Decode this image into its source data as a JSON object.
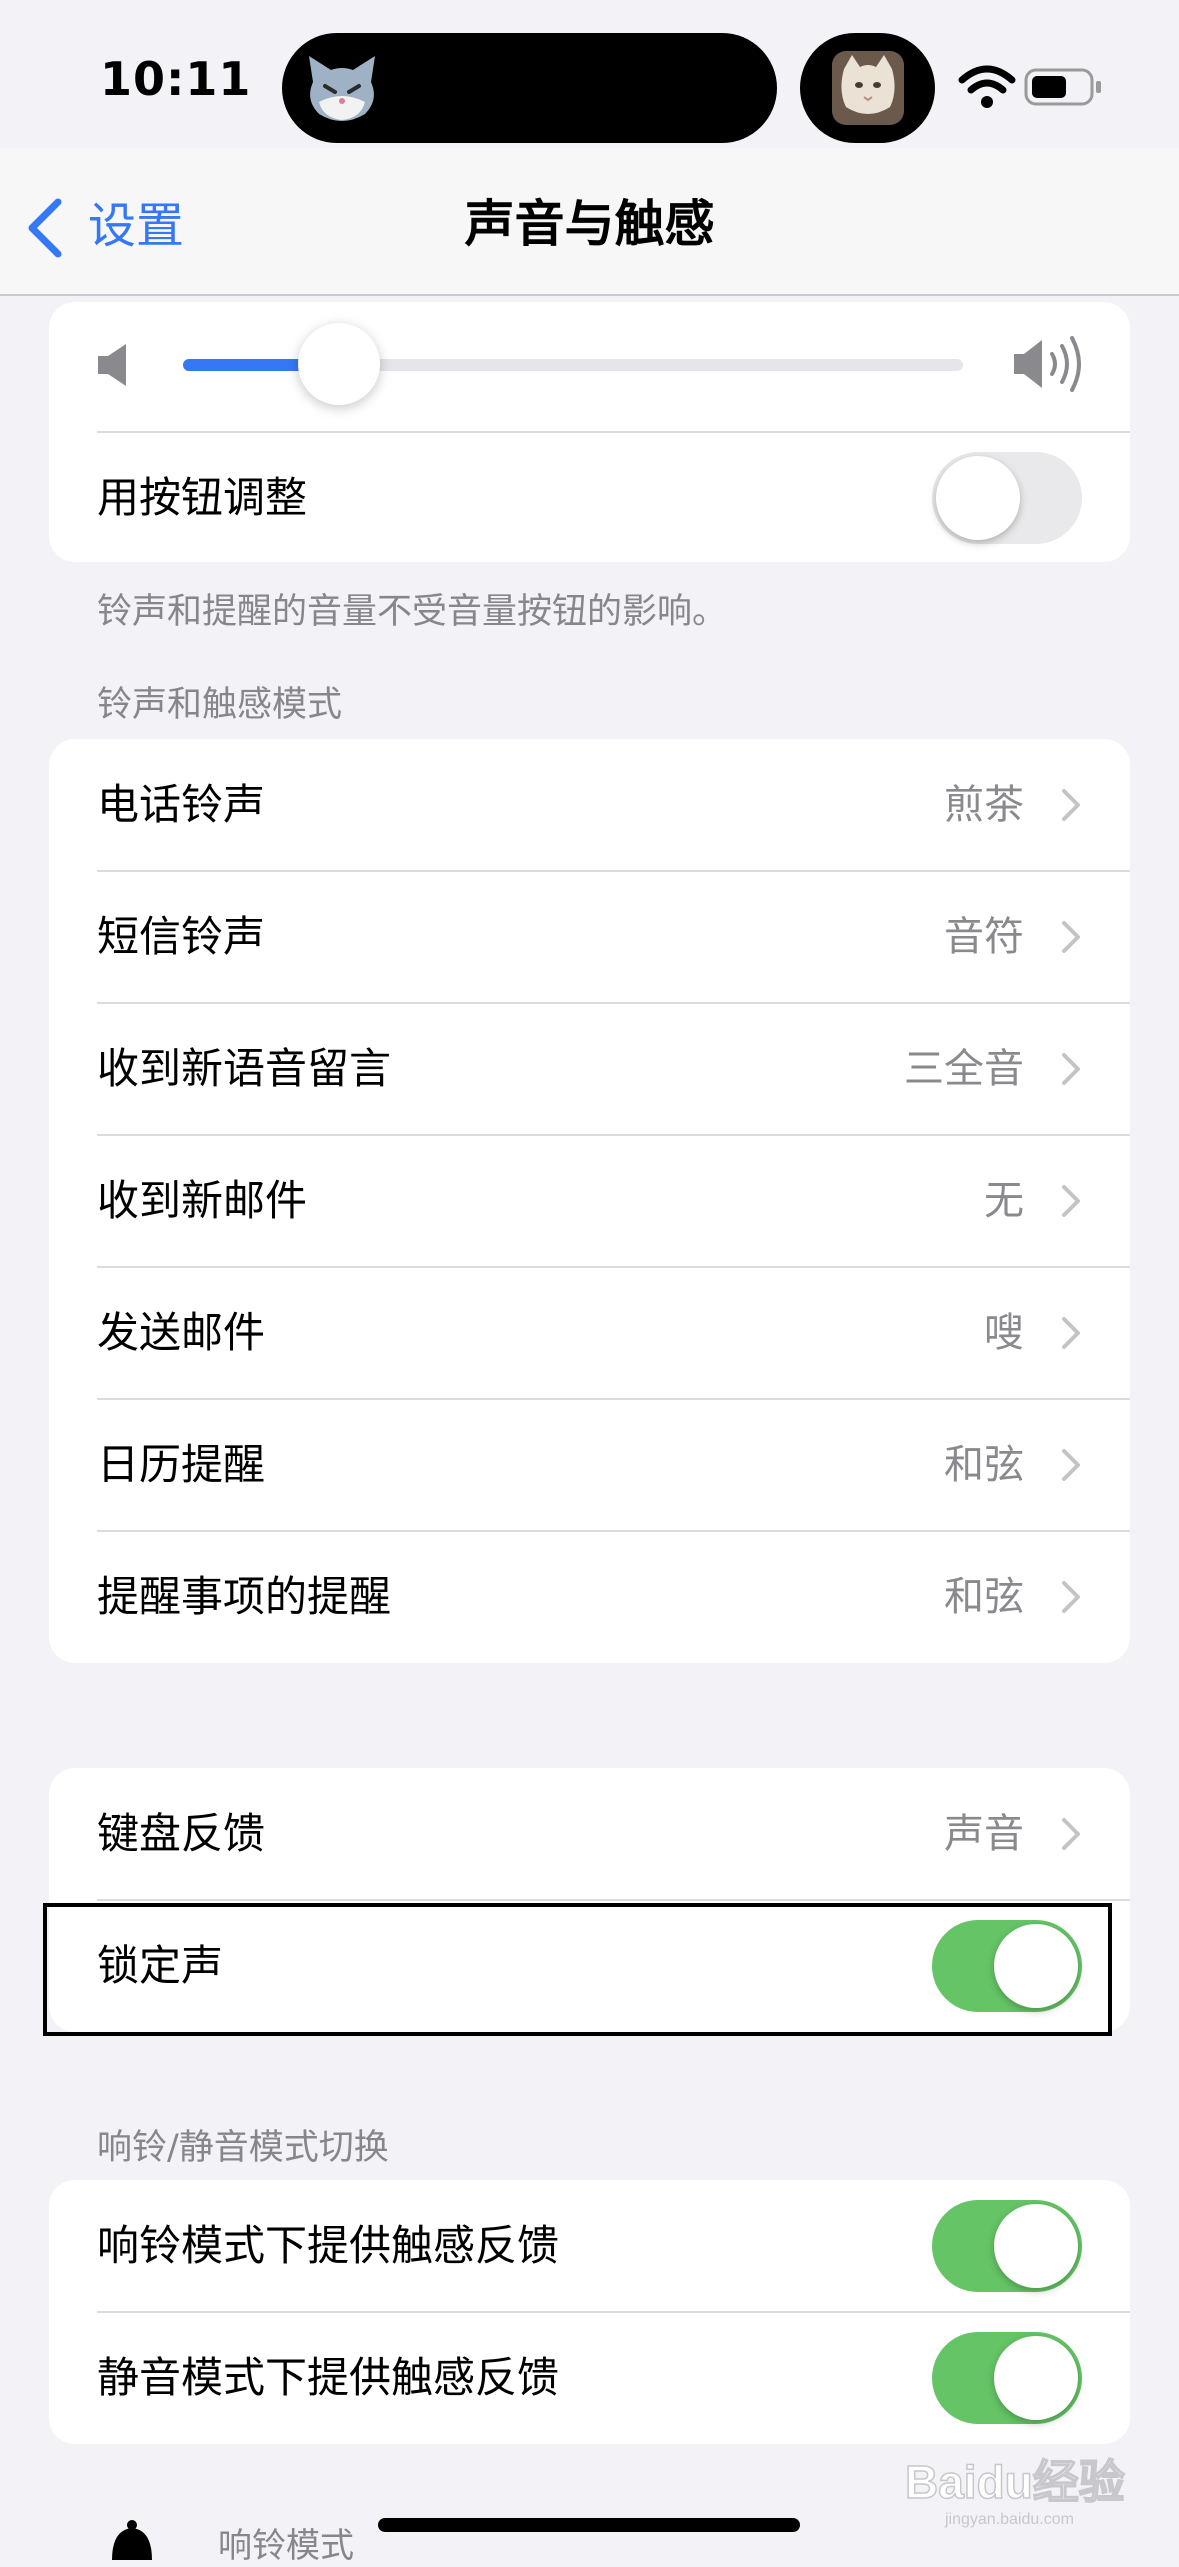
{
  "status_bar": {
    "time": "10:11"
  },
  "nav": {
    "back_label": "设置",
    "title": "声音与触感"
  },
  "volume": {
    "level": 0.2,
    "button_adjust_label": "用按钮调整",
    "button_adjust_on": false,
    "footer": "铃声和提醒的音量不受音量按钮的影响。"
  },
  "ringtone_section": {
    "header": "铃声和触感模式",
    "rows": [
      {
        "label": "电话铃声",
        "value": "煎茶"
      },
      {
        "label": "短信铃声",
        "value": "音符"
      },
      {
        "label": "收到新语音留言",
        "value": "三全音"
      },
      {
        "label": "收到新邮件",
        "value": "无"
      },
      {
        "label": "发送邮件",
        "value": "嗖"
      },
      {
        "label": "日历提醒",
        "value": "和弦"
      },
      {
        "label": "提醒事项的提醒",
        "value": "和弦"
      }
    ]
  },
  "feedback_section": {
    "keyboard_label": "键盘反馈",
    "keyboard_value": "声音",
    "lock_sound_label": "锁定声",
    "lock_sound_on": true
  },
  "haptics_section": {
    "header": "响铃/静音模式切换",
    "ring_label": "响铃模式下提供触感反馈",
    "ring_on": true,
    "silent_label": "静音模式下提供触感反馈",
    "silent_on": true
  },
  "bottom": {
    "ring_mode_label": "响铃模式"
  },
  "watermark": {
    "text": "Baidu经验",
    "subtext": "jingyan.baidu.com"
  },
  "colors": {
    "accent": "#3478f6",
    "toggle_on": "#65c466",
    "toggle_off": "#e9e9eb",
    "background": "#f2f2f7"
  },
  "icons": [
    "speaker-low-icon",
    "speaker-high-icon",
    "chevron-left-icon",
    "chevron-right-icon",
    "wifi-icon",
    "battery-icon",
    "bell-icon"
  ]
}
